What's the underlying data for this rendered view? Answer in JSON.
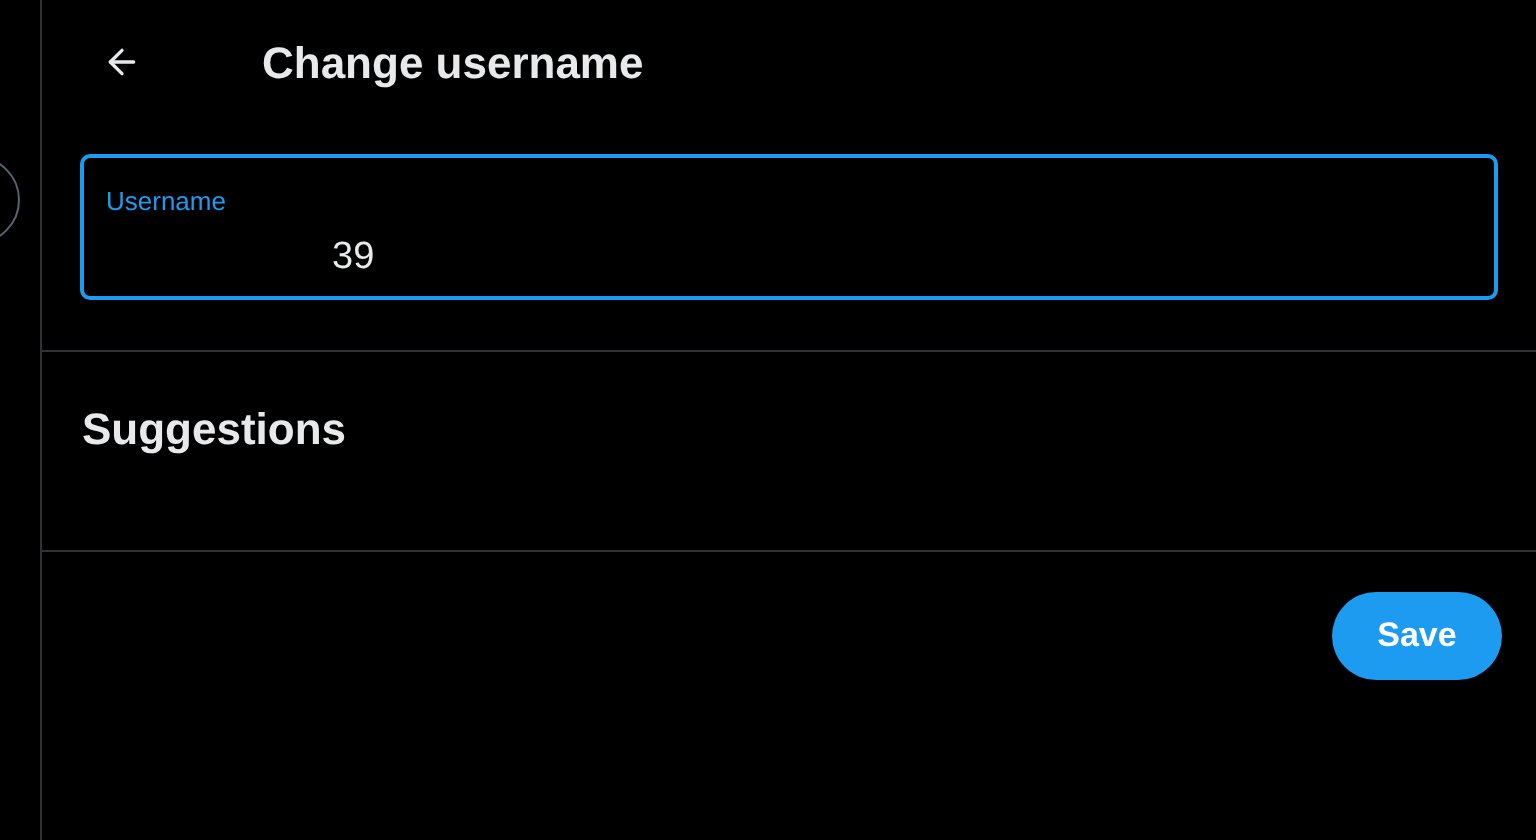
{
  "header": {
    "title": "Change username"
  },
  "username_field": {
    "label": "Username",
    "value": "39",
    "focused": true
  },
  "suggestions": {
    "title": "Suggestions"
  },
  "buttons": [
    {
      "label": "Save"
    }
  ]
}
